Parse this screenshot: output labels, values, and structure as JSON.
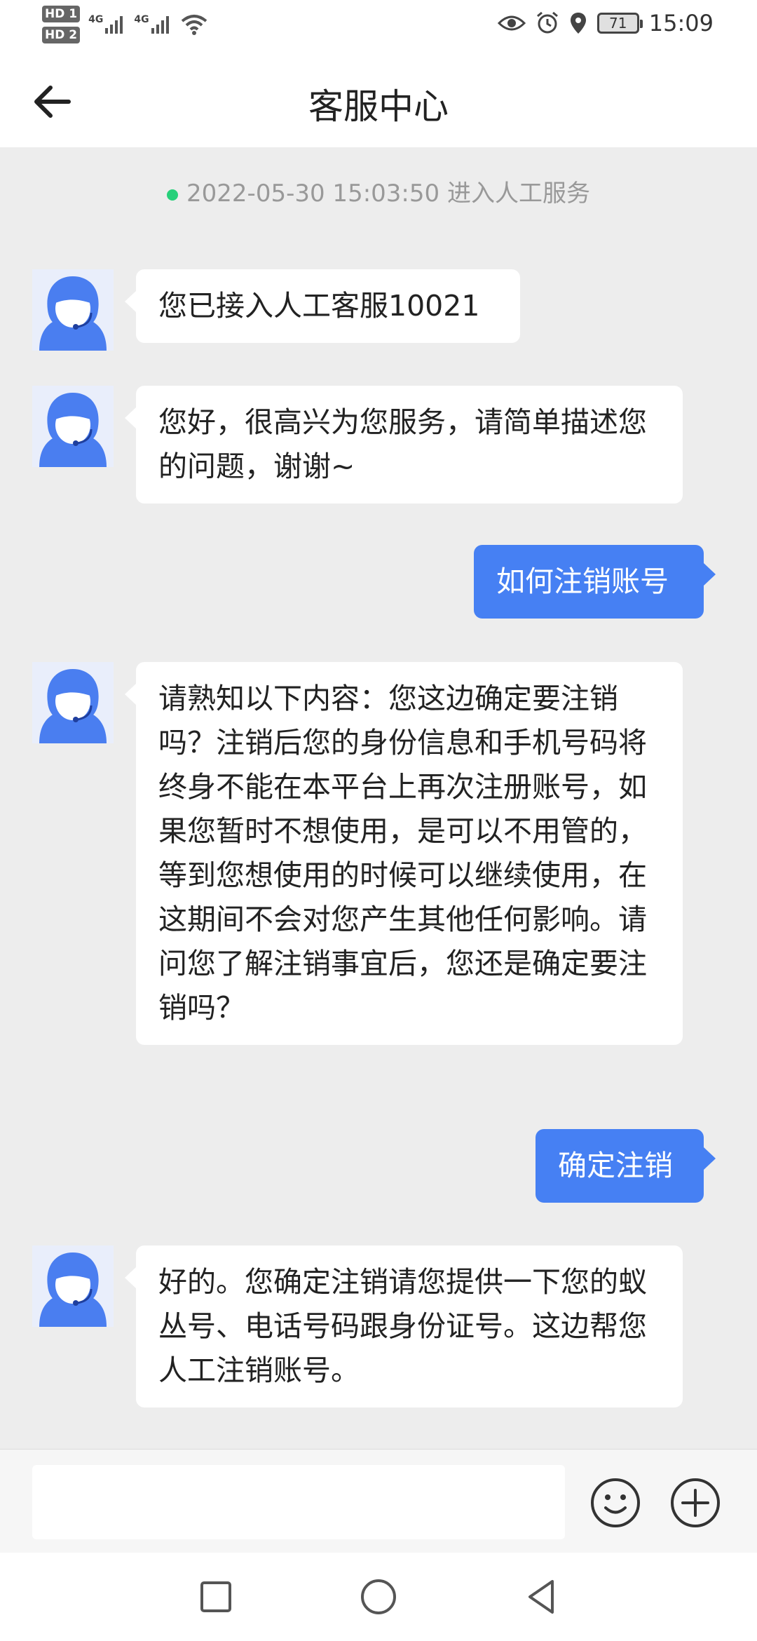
{
  "status_bar": {
    "sim1": "HD 1",
    "sim2": "HD 2",
    "net1": "4G",
    "net2": "4G",
    "battery": "71",
    "time": "15:09",
    "icons": [
      "eye-icon",
      "alarm-icon",
      "location-icon",
      "battery-icon",
      "wifi-icon",
      "signal-icon"
    ]
  },
  "header": {
    "title": "客服中心",
    "back_icon": "arrow-left-icon"
  },
  "chat": {
    "system_message": "2022-05-30 15:03:50 进入人工服务",
    "status_color": "#27d07a",
    "messages": [
      {
        "from": "agent",
        "text": "您已接入人工客服10021"
      },
      {
        "from": "agent",
        "text": "您好，很高兴为您服务，请简单描述您的问题，谢谢~"
      },
      {
        "from": "user",
        "text": "如何注销账号"
      },
      {
        "from": "agent",
        "text": "请熟知以下内容：您这边确定要注销吗？注销后您的身份信息和手机号码将终身不能在本平台上再次注册账号，如果您暂时不想使用，是可以不用管的，等到您想使用的时候可以继续使用，在这期间不会对您产生其他任何影响。请问您了解注销事宜后，您还是确定要注销吗？"
      },
      {
        "from": "user",
        "text": "确定注销"
      },
      {
        "from": "agent",
        "text": "好的。您确定注销请您提供一下您的蚁丛号、电话号码跟身份证号。这边帮您人工注销账号。"
      }
    ]
  },
  "input_bar": {
    "value": "",
    "emoji_icon": "smiley-icon",
    "plus_icon": "plus-circle-icon"
  },
  "nav_bar": {
    "icons": [
      "recents-square-icon",
      "home-circle-icon",
      "back-triangle-icon"
    ]
  },
  "colors": {
    "accent": "#4680f3",
    "background": "#ededed",
    "bubble": "#ffffff"
  }
}
